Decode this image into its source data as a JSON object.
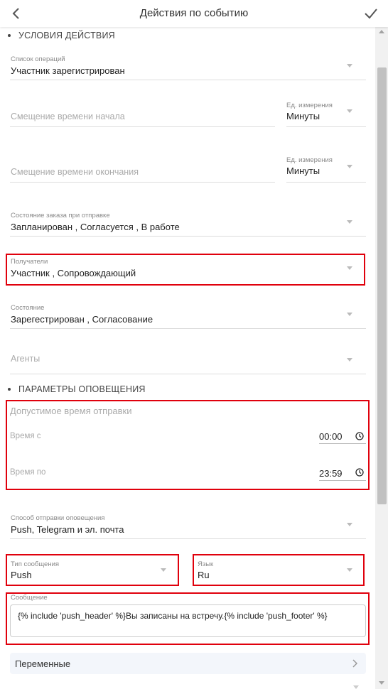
{
  "header": {
    "title": "Действия по событию",
    "back_icon": "chevron-left-icon",
    "confirm_icon": "check-icon"
  },
  "section_conditions": {
    "title": "УСЛОВИЯ ДЕЙСТВИЯ",
    "operations": {
      "label": "Список операций",
      "value": "Участник зарегистрирован"
    },
    "start_offset": {
      "placeholder": "Смещение времени начала",
      "unit_label": "Ед. измерения",
      "unit_value": "Минуты"
    },
    "end_offset": {
      "placeholder": "Смещение времени окончания",
      "unit_label": "Ед. измерения",
      "unit_value": "Минуты"
    },
    "order_state": {
      "label": "Состояние заказа при отправке",
      "value": "Запланирован , Согласуется , В работе"
    },
    "recipients": {
      "label": "Получатели",
      "value": "Участник , Сопровождающий"
    },
    "state": {
      "label": "Состояние",
      "value": "Зарегестрирован , Согласование"
    },
    "agents": {
      "placeholder": "Агенты"
    }
  },
  "section_notify": {
    "title": "ПАРАМЕТРЫ ОПОВЕЩЕНИЯ",
    "allowed_time": {
      "title": "Допустимое время отправки",
      "from_label": "Время с",
      "from_value": "00:00",
      "to_label": "Время по",
      "to_value": "23:59"
    },
    "method": {
      "label": "Способ отправки оповещения",
      "value": "Push, Telegram и эл. почта"
    },
    "message_type": {
      "label": "Тип сообщения",
      "value": "Push"
    },
    "language": {
      "label": "Язык",
      "value": "Ru"
    },
    "message": {
      "label": "Сообщение",
      "value": "{% include 'push_header' %}Вы записаны на встречу.{% include 'push_footer' %}"
    },
    "variables": {
      "label": "Переменные"
    }
  },
  "colors": {
    "highlight": "#e0000c",
    "accent_bg": "#f3f6fb",
    "text": "#222222",
    "muted": "#888888"
  }
}
